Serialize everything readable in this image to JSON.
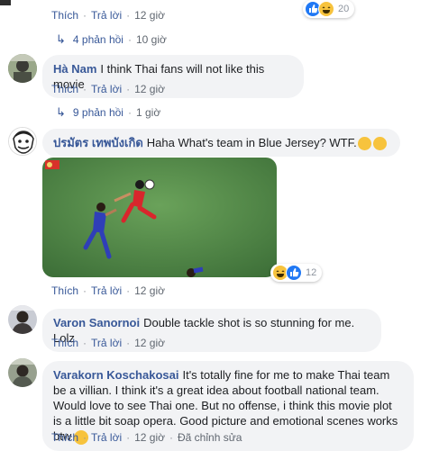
{
  "top_comment": {
    "reaction_count": "20",
    "actions": {
      "like": "Thích",
      "reply": "Trả lời",
      "time": "12 giờ"
    },
    "replies": {
      "label": "4 phản hồi",
      "time": "10 giờ"
    }
  },
  "comments": [
    {
      "author": "Hà Nam",
      "text": "I think Thai fans will not like this movie",
      "actions": {
        "like": "Thích",
        "reply": "Trả lời",
        "time": "12 giờ"
      },
      "replies": {
        "label": "9 phản hồi",
        "time": "1 giờ"
      }
    },
    {
      "author": "ปรมัตร เทพบังเกิด",
      "text": "Haha What's team in Blue Jersey? WTF.",
      "reaction_count": "12",
      "actions": {
        "like": "Thích",
        "reply": "Trả lời",
        "time": "12 giờ"
      }
    },
    {
      "author": "Varon Sanornoi",
      "text": "Double tackle shot is so stunning for me. Lolz",
      "actions": {
        "like": "Thích",
        "reply": "Trả lời",
        "time": "12 giờ"
      }
    },
    {
      "author": "Varakorn Koschakosai",
      "text": "It's totally fine for me to make Thai team be a villian. I think it's a great idea about football national team. Would love to see Thai one. But no offense, i think this movie plot is a little bit soap opera. Good picture and emotional scenes works btw",
      "actions": {
        "like": "Thích",
        "reply": "Trả lời",
        "time": "12 giờ",
        "edited": "Đã chỉnh sửa"
      }
    }
  ],
  "colors": {
    "link": "#385898",
    "bubble": "#f2f3f5",
    "meta": "#606770",
    "pitch": "#4f8a45"
  },
  "icons": [
    "thumbs-up-icon",
    "laughing-emoji-icon",
    "reply-arrow-icon",
    "avatar"
  ]
}
